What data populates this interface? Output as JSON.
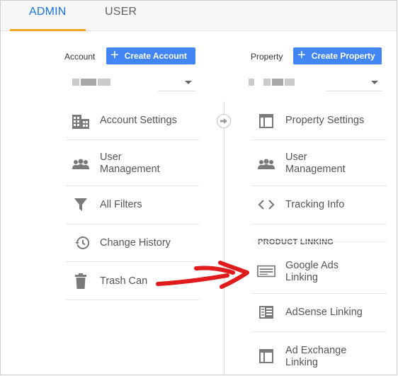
{
  "tabs": [
    {
      "label": "ADMIN",
      "active": true
    },
    {
      "label": "USER",
      "active": false
    }
  ],
  "account": {
    "column_label": "Account",
    "create_label": "Create Account"
  },
  "property": {
    "column_label": "Property",
    "create_label": "Create Property"
  },
  "account_menu": [
    {
      "label": "Account Settings",
      "icon": "building-icon"
    },
    {
      "label": "User\nManagement",
      "icon": "people-icon"
    },
    {
      "label": "All Filters",
      "icon": "filter-icon"
    },
    {
      "label": "Change History",
      "icon": "history-icon"
    },
    {
      "label": "Trash Can",
      "icon": "trash-icon"
    }
  ],
  "property_menu": [
    {
      "label": "Property Settings",
      "icon": "window-icon"
    },
    {
      "label": "User\nManagement",
      "icon": "people-icon"
    },
    {
      "label": "Tracking Info",
      "icon": "code-icon"
    }
  ],
  "product_linking": {
    "heading": "PRODUCT LINKING",
    "items": [
      {
        "label": "Google Ads\nLinking",
        "icon": "ads-icon"
      },
      {
        "label": "AdSense Linking",
        "icon": "adsense-icon"
      },
      {
        "label": "Ad Exchange\nLinking",
        "icon": "window-icon"
      }
    ]
  },
  "colors": {
    "accent_blue": "#4285f4",
    "tab_active": "#1a73e8",
    "tab_underline": "#f4a521",
    "annotation_red": "#e01b1b"
  }
}
